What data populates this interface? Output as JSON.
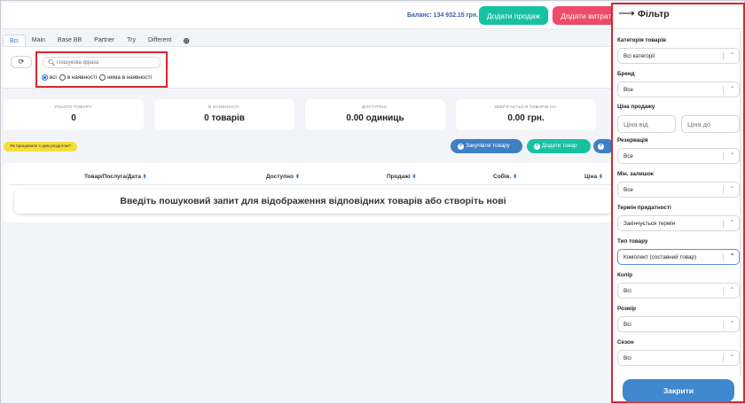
{
  "topbar": {
    "balance": "Баланс: 134 932.15 грн.",
    "add_sale": "Додати продаж",
    "add_expense": "Додати витрату"
  },
  "tabs": [
    "Всі",
    "Main",
    "Base BB",
    "Partner",
    "Try",
    "Different"
  ],
  "search": {
    "placeholder": "Пошукова фраза",
    "radio_all": "всі",
    "radio_in_stock": "в наявності",
    "radio_out_of_stock": "нема в наявності",
    "selected": "всі"
  },
  "stats": [
    {
      "label": "УСЬОГО ТОВАРУ:",
      "value": "0"
    },
    {
      "label": "В НАЯВНОСТІ:",
      "value": "0 товарів"
    },
    {
      "label": "ДОСТУПНО:",
      "value": "0.00 одиниць"
    },
    {
      "label": "ЗБЕРІГАЄТЬСЯ ТОВАРІВ НА:",
      "value": "0.00 грн."
    }
  ],
  "help_badge": "Як працювати з цим розділом?",
  "actions": {
    "batch": "Закупівля товару",
    "add": "Додати товар"
  },
  "table": {
    "columns": [
      "Товар/Послуга/Дата",
      "Доступно",
      "Продажі",
      "Собів.",
      "Ціна"
    ],
    "empty_message": "Введіть пошуковий запит для відображення відповідних товарів або створіть нові"
  },
  "filter": {
    "title": "Фільтр",
    "fields": [
      {
        "label": "Категорія товарів",
        "value": "Всі категорії"
      },
      {
        "label": "Бренд",
        "value": "Все"
      },
      {
        "label": "Ціна продажу",
        "from_placeholder": "Ціна від",
        "to_placeholder": "Ціна до"
      },
      {
        "label": "Резервація",
        "value": "Все"
      },
      {
        "label": "Мін. залишок",
        "value": "Все"
      },
      {
        "label": "Термін придатності",
        "value": "Закінчується термін"
      },
      {
        "label": "Тип товару",
        "value": "Комплект (составний товар)"
      },
      {
        "label": "Колір",
        "value": "Всі"
      },
      {
        "label": "Розмір",
        "value": "Всі"
      },
      {
        "label": "Сезон",
        "value": "Всі"
      }
    ],
    "close": "Закрити"
  },
  "colors": {
    "accent_blue": "#3f7fc4",
    "teal": "#18c1a2",
    "red": "#ef4a68",
    "highlight": "#d9262c"
  }
}
